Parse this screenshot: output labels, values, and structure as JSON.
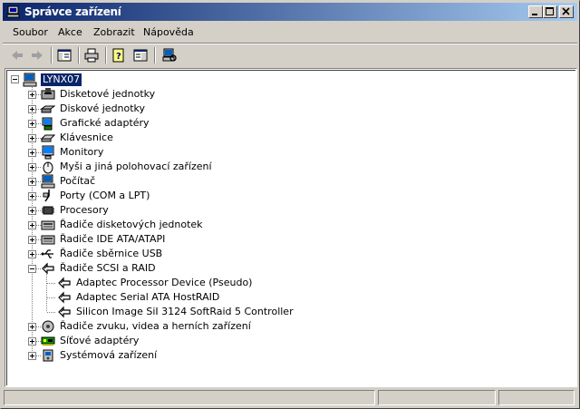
{
  "window": {
    "title": "Správce zařízení"
  },
  "menu": {
    "items": [
      {
        "label": "Soubor"
      },
      {
        "label": "Akce"
      },
      {
        "label": "Zobrazit"
      },
      {
        "label": "Nápověda"
      }
    ]
  },
  "toolbar": {
    "buttons": [
      "back-icon",
      "forward-icon",
      "tree-view-icon",
      "print-icon",
      "help-icon",
      "properties-icon",
      "scan-hardware-icon"
    ]
  },
  "tree": {
    "root": "LYNX07",
    "categories": [
      {
        "label": "Disketové jednotky",
        "icon": "floppy-drive-icon"
      },
      {
        "label": "Diskové jednotky",
        "icon": "disk-drive-icon"
      },
      {
        "label": "Grafické adaptéry",
        "icon": "display-adapter-icon"
      },
      {
        "label": "Klávesnice",
        "icon": "keyboard-icon"
      },
      {
        "label": "Monitory",
        "icon": "monitor-icon"
      },
      {
        "label": "Myši a jiná polohovací zařízení",
        "icon": "mouse-icon"
      },
      {
        "label": "Počítač",
        "icon": "computer-icon"
      },
      {
        "label": "Porty (COM a LPT)",
        "icon": "port-icon"
      },
      {
        "label": "Procesory",
        "icon": "processor-icon"
      },
      {
        "label": "Řadiče disketových jednotek",
        "icon": "floppy-controller-icon"
      },
      {
        "label": "Řadiče IDE ATA/ATAPI",
        "icon": "ide-controller-icon"
      },
      {
        "label": "Řadiče sběrnice USB",
        "icon": "usb-icon"
      },
      {
        "label": "Řadiče SCSI a RAID",
        "icon": "scsi-icon"
      },
      {
        "label": "Řadiče zvuku, videa a herních zařízení",
        "icon": "sound-icon"
      },
      {
        "label": "Síťové adaptéry",
        "icon": "network-adapter-icon"
      },
      {
        "label": "Systémová zařízení",
        "icon": "system-device-icon"
      }
    ],
    "scsi_children": [
      {
        "label": "Adaptec Processor Device (Pseudo)"
      },
      {
        "label": "Adaptec Serial ATA HostRAID"
      },
      {
        "label": "Silicon Image SiI 3124 SoftRaid 5 Controller"
      }
    ]
  },
  "colors": {
    "titlebar_start": "#0a246a",
    "titlebar_end": "#a6caf0",
    "selection": "#0a246a",
    "face": "#d4d0c8"
  }
}
